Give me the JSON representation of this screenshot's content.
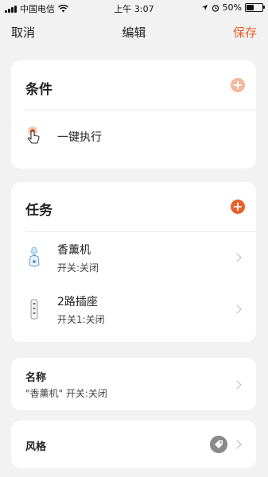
{
  "status_bar": {
    "carrier": "中国电信",
    "time": "上午 3:07",
    "battery": "50%",
    "battery_level": 0.5
  },
  "nav": {
    "cancel": "取消",
    "title": "编辑",
    "save": "保存"
  },
  "conditions": {
    "title": "条件",
    "add_color": "#f4b89a",
    "items": [
      {
        "label": "一键执行",
        "icon": "hand-tap-icon"
      }
    ]
  },
  "tasks": {
    "title": "任务",
    "add_color": "#e8602c",
    "items": [
      {
        "name": "香薰机",
        "detail": "开关:关闭",
        "icon": "aroma-diffuser-icon"
      },
      {
        "name": "2路插座",
        "detail": "开关1:关闭",
        "icon": "power-strip-icon"
      }
    ]
  },
  "name_section": {
    "label": "名称",
    "value": "\"香薰机\" 开关:关闭"
  },
  "style_section": {
    "label": "风格",
    "icon": "tag-icon"
  },
  "colors": {
    "accent": "#e8602c",
    "background": "#f2f2f2"
  }
}
